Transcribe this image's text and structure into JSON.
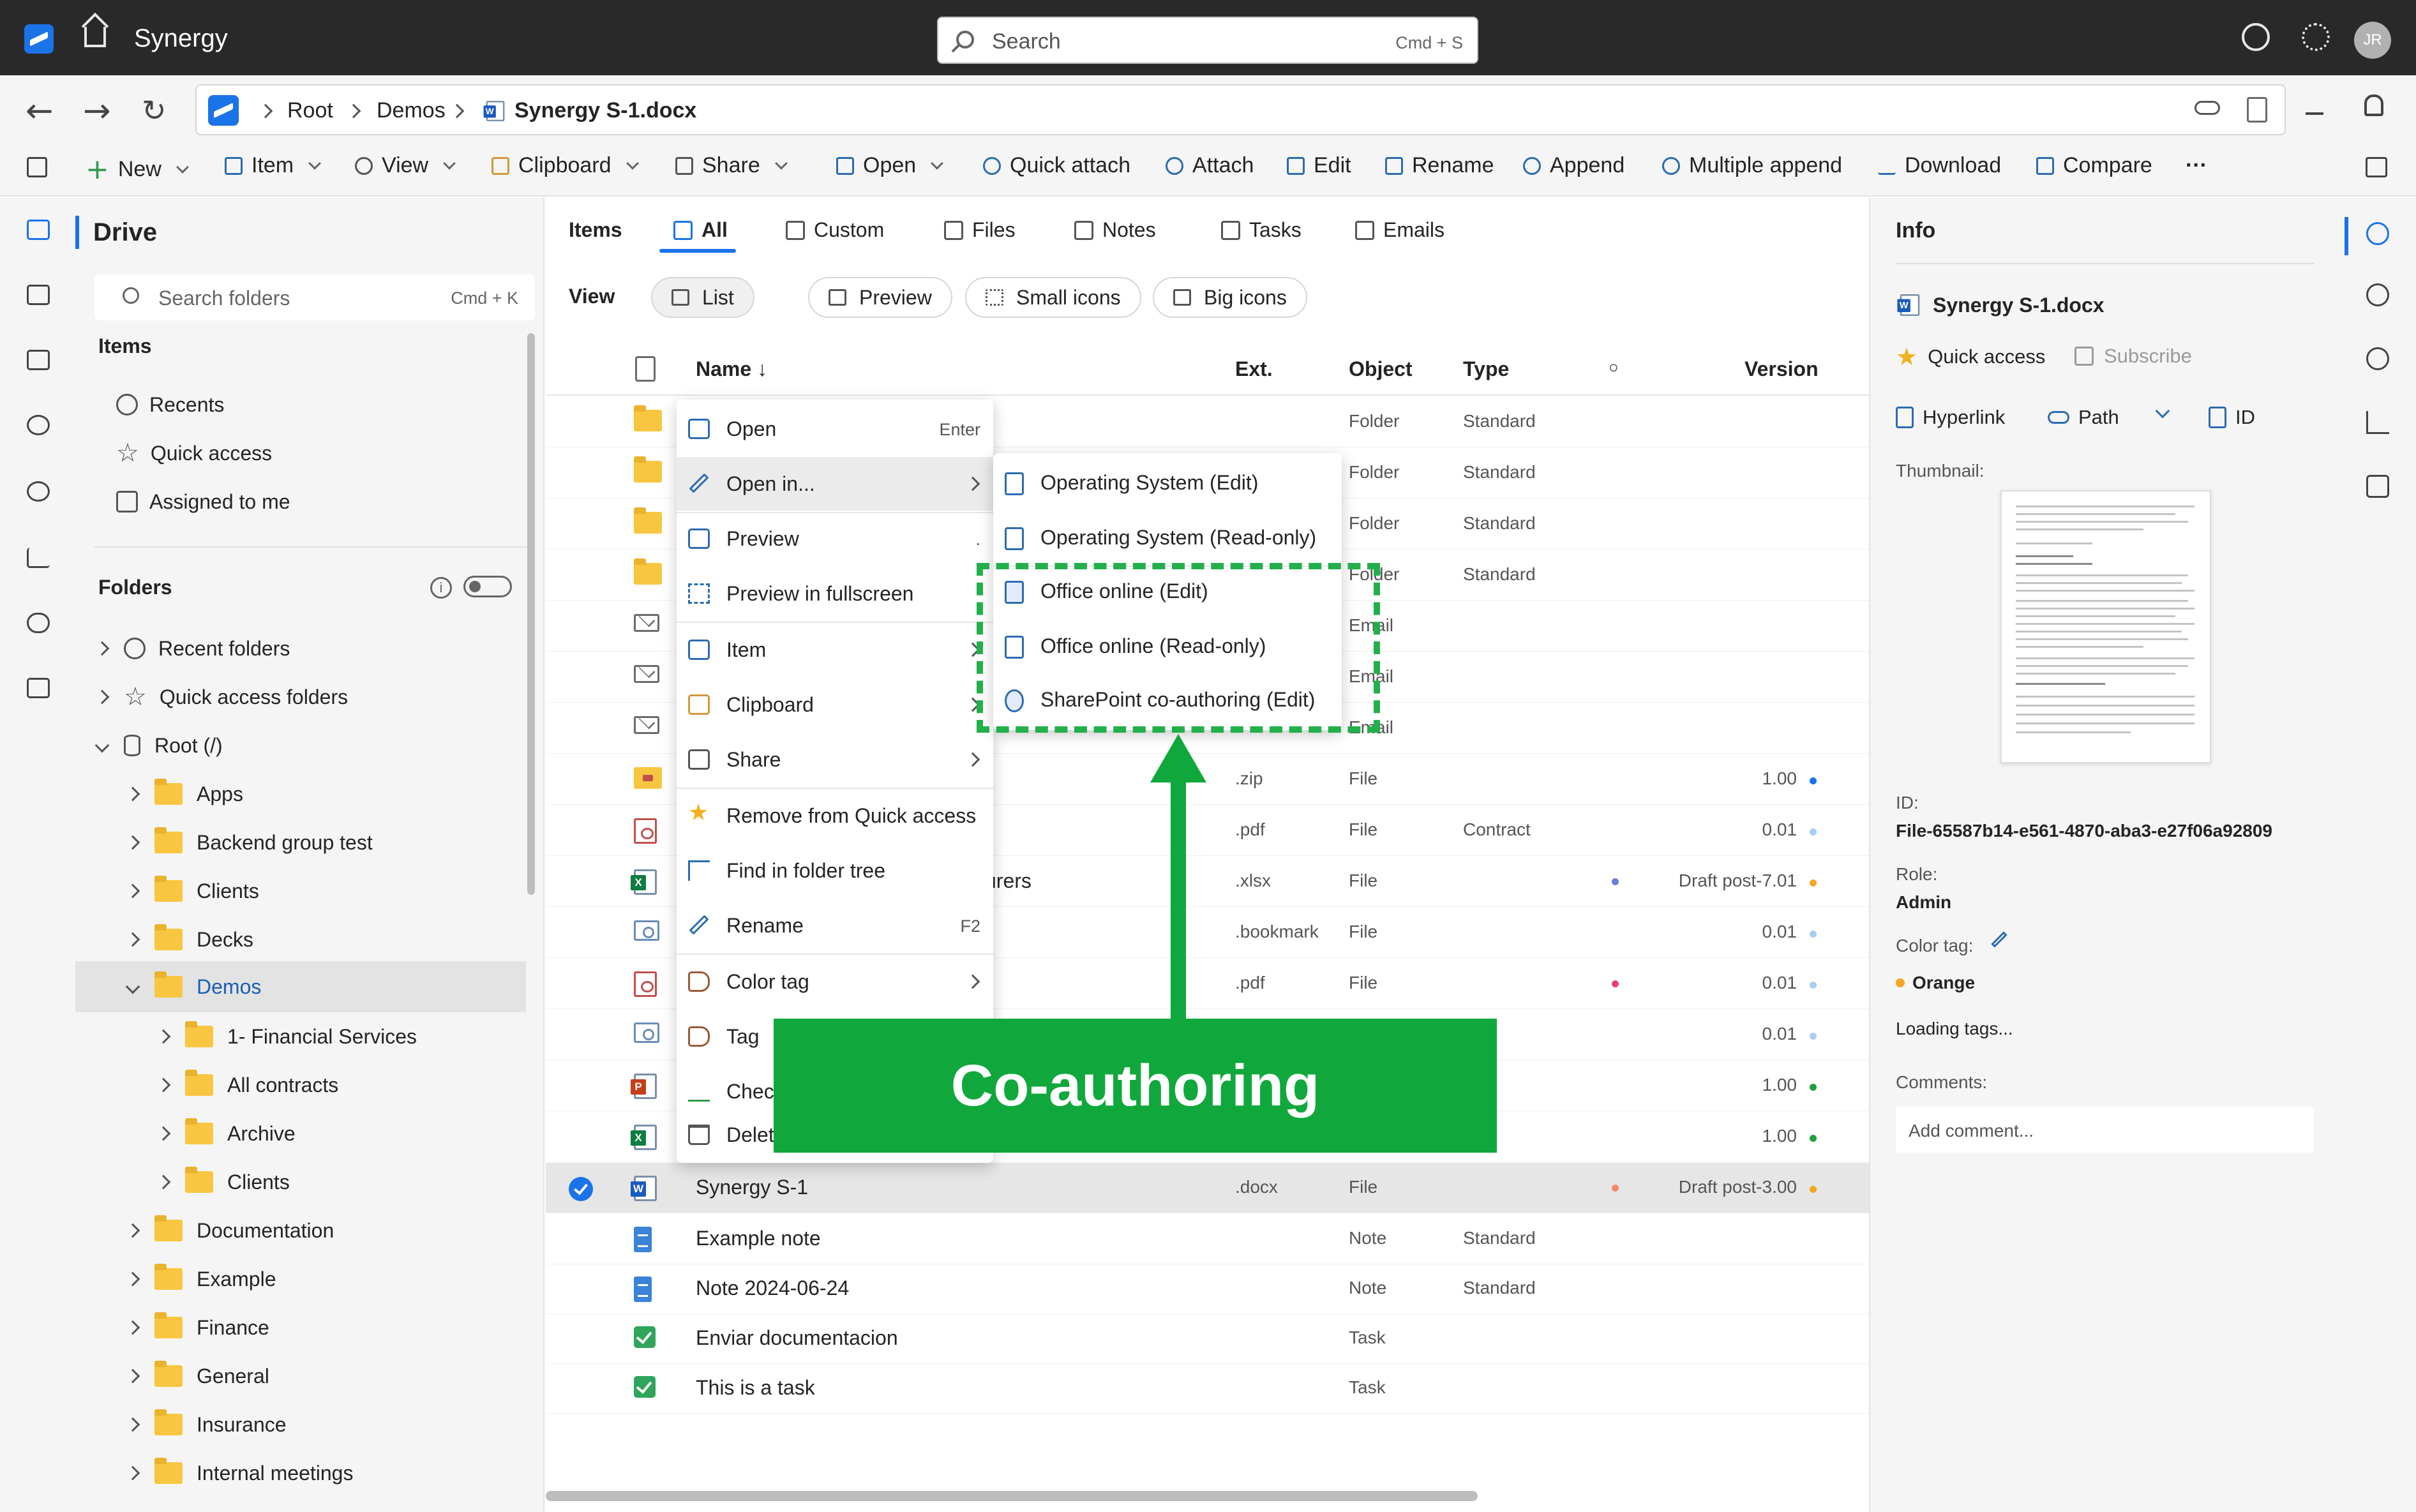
{
  "titlebar": {
    "app_name": "Synergy",
    "search_placeholder": "Search",
    "search_shortcut": "Cmd + S",
    "avatar_initials": "JR"
  },
  "addressbar": {
    "crumbs": [
      "Root",
      "Demos",
      "Synergy S-1.docx"
    ]
  },
  "toolbar": {
    "new": "New",
    "item": "Item",
    "view": "View",
    "clipboard": "Clipboard",
    "share": "Share",
    "open": "Open",
    "quick_attach": "Quick attach",
    "attach": "Attach",
    "edit": "Edit",
    "rename": "Rename",
    "append": "Append",
    "multiple_append": "Multiple append",
    "download": "Download",
    "compare": "Compare",
    "more": "···"
  },
  "sidebar": {
    "title": "Drive",
    "search_placeholder": "Search folders",
    "search_shortcut": "Cmd + K",
    "items_heading": "Items",
    "items": [
      "Recents",
      "Quick access",
      "Assigned to me"
    ],
    "folders_heading": "Folders",
    "folders_info": "i",
    "tree": [
      {
        "label": "Recent folders",
        "depth": 0
      },
      {
        "label": "Quick access folders",
        "depth": 0
      },
      {
        "label": "Root (/)",
        "depth": 0
      },
      {
        "label": "Apps",
        "depth": 1
      },
      {
        "label": "Backend group test",
        "depth": 1
      },
      {
        "label": "Clients",
        "depth": 1
      },
      {
        "label": "Decks",
        "depth": 1
      },
      {
        "label": "Demos",
        "depth": 1
      },
      {
        "label": "1- Financial Services",
        "depth": 2
      },
      {
        "label": "All contracts",
        "depth": 2
      },
      {
        "label": "Archive",
        "depth": 2
      },
      {
        "label": "Clients",
        "depth": 2
      },
      {
        "label": "Documentation",
        "depth": 1
      },
      {
        "label": "Example",
        "depth": 1
      },
      {
        "label": "Finance",
        "depth": 1
      },
      {
        "label": "General",
        "depth": 1
      },
      {
        "label": "Insurance",
        "depth": 1
      },
      {
        "label": "Internal meetings",
        "depth": 1
      }
    ]
  },
  "main": {
    "tabs_label": "Items",
    "tabs": [
      "All",
      "Custom",
      "Files",
      "Notes",
      "Tasks",
      "Emails"
    ],
    "view_label": "View",
    "view_modes": [
      "List",
      "Preview",
      "Small icons",
      "Big icons"
    ],
    "columns": {
      "name": "Name ↓",
      "ext": "Ext.",
      "object": "Object",
      "type": "Type",
      "status": "○",
      "version": "Version"
    },
    "rows": [
      {
        "name": "",
        "ext": "",
        "object": "Folder",
        "type": "Standard",
        "version": ""
      },
      {
        "name": "",
        "ext": "",
        "object": "Folder",
        "type": "Standard",
        "version": ""
      },
      {
        "name": "",
        "ext": "",
        "object": "Folder",
        "type": "Standard",
        "version": ""
      },
      {
        "name": "",
        "ext": "",
        "object": "Folder",
        "type": "Standard",
        "version": ""
      },
      {
        "name": "",
        "ext": "",
        "object": "Email",
        "type": "",
        "version": ""
      },
      {
        "name": "",
        "ext": "",
        "object": "Email",
        "type": "",
        "version": ""
      },
      {
        "name": "",
        "ext": "",
        "object": "Email",
        "type": "",
        "version": ""
      },
      {
        "name": "",
        "ext": ".zip",
        "object": "File",
        "type": "",
        "version": "1.00"
      },
      {
        "name": "",
        "ext": ".pdf",
        "object": "File",
        "type": "Contract",
        "version": "0.01"
      },
      {
        "name": "urers",
        "ext": ".xlsx",
        "object": "File",
        "type": "",
        "version": "Draft post-7.01"
      },
      {
        "name": "",
        "ext": ".bookmark",
        "object": "File",
        "type": "",
        "version": "0.01"
      },
      {
        "name": "",
        "ext": ".pdf",
        "object": "File",
        "type": "",
        "version": "0.01"
      },
      {
        "name": "",
        "ext": "",
        "object": "",
        "type": "",
        "version": "0.01"
      },
      {
        "name": "",
        "ext": "",
        "object": "",
        "type": "",
        "version": "1.00"
      },
      {
        "name": "",
        "ext": "",
        "object": "",
        "type": "",
        "version": "1.00"
      },
      {
        "name": "Synergy S-1",
        "ext": ".docx",
        "object": "File",
        "type": "",
        "version": "Draft post-3.00"
      },
      {
        "name": "Example note",
        "ext": "",
        "object": "Note",
        "type": "Standard",
        "version": ""
      },
      {
        "name": "Note 2024-06-24",
        "ext": "",
        "object": "Note",
        "type": "Standard",
        "version": ""
      },
      {
        "name": "Enviar documentacion",
        "ext": "",
        "object": "Task",
        "type": "",
        "version": ""
      },
      {
        "name": "This is a task",
        "ext": "",
        "object": "Task",
        "type": "",
        "version": ""
      }
    ]
  },
  "context_menu": {
    "items": [
      {
        "label": "Open",
        "shortcut": "Enter"
      },
      {
        "label": "Open in...",
        "shortcut": ""
      },
      {
        "label": "Preview",
        "shortcut": "."
      },
      {
        "label": "Preview in fullscreen",
        "shortcut": ""
      },
      {
        "label": "Item",
        "shortcut": ""
      },
      {
        "label": "Clipboard",
        "shortcut": ""
      },
      {
        "label": "Share",
        "shortcut": ""
      },
      {
        "label": "Remove from Quick access",
        "shortcut": ""
      },
      {
        "label": "Find in folder tree",
        "shortcut": ""
      },
      {
        "label": "Rename",
        "shortcut": "F2"
      },
      {
        "label": "Color tag",
        "shortcut": ""
      },
      {
        "label": "Tag",
        "shortcut": ""
      },
      {
        "label": "Chec",
        "shortcut": ""
      },
      {
        "label": "Delet",
        "shortcut": ""
      }
    ]
  },
  "submenu": {
    "items": [
      "Operating System (Edit)",
      "Operating System (Read-only)",
      "Office online (Edit)",
      "Office online (Read-only)",
      "SharePoint co-authoring (Edit)"
    ]
  },
  "annotation": {
    "callout": "Co-authoring",
    "color": "#10a83c"
  },
  "info": {
    "title": "Info",
    "filename": "Synergy S-1.docx",
    "quick_access": "Quick access",
    "subscribe": "Subscribe",
    "hyperlink": "Hyperlink",
    "path": "Path",
    "id_btn": "ID",
    "thumbnail_label": "Thumbnail:",
    "id_label": "ID:",
    "id_value": "File-65587b14-e561-4870-aba3-e27f06a92809",
    "role_label": "Role:",
    "role_value": "Admin",
    "color_tag_label": "Color tag:",
    "color_tag_value": "Orange",
    "loading_tags": "Loading tags...",
    "comments_label": "Comments:",
    "add_comment": "Add comment..."
  },
  "colors": {
    "accent": "#1a73e8",
    "titlebar": "#292929",
    "dot_blue": "#1a73e8",
    "dot_lightblue": "#a9cdf4",
    "dot_orange": "#f5a623",
    "dot_green": "#1e9e3e",
    "dot_pink": "#e8436b",
    "dot_purple": "#6b7fd9",
    "dot_salmon": "#f28b6b"
  }
}
